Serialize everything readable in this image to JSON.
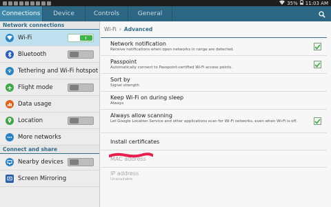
{
  "status_bar": {
    "battery": "35%",
    "time": "11:03 AM"
  },
  "tabs": [
    {
      "label": "Connections",
      "active": true
    },
    {
      "label": "Device",
      "active": false
    },
    {
      "label": "Controls",
      "active": false
    },
    {
      "label": "General",
      "active": false
    }
  ],
  "sidebar": {
    "section_network": "Network connections",
    "section_share": "Connect and share",
    "items": [
      {
        "label": "Wi-Fi",
        "icon": "wifi-icon",
        "color": "#2c83c2",
        "switch": "on"
      },
      {
        "label": "Bluetooth",
        "icon": "bluetooth-icon",
        "color": "#2a5fb8",
        "switch": "off"
      },
      {
        "label": "Tethering and Wi-Fi hotspot",
        "icon": "hotspot-icon",
        "color": "#2c83c2",
        "switch": null
      },
      {
        "label": "Flight mode",
        "icon": "airplane-icon",
        "color": "#3fa547",
        "switch": "off"
      },
      {
        "label": "Data usage",
        "icon": "data-usage-icon",
        "color": "#e0621f",
        "switch": null
      },
      {
        "label": "Location",
        "icon": "location-icon",
        "color": "#3fa547",
        "switch": "off"
      },
      {
        "label": "More networks",
        "icon": "more-networks-icon",
        "color": "#2c83c2",
        "switch": null
      },
      {
        "label": "Nearby devices",
        "icon": "nearby-devices-icon",
        "color": "#2c83c2",
        "switch": "off"
      },
      {
        "label": "Screen Mirroring",
        "icon": "screen-mirroring-icon",
        "color": "#2c5fa8",
        "switch": null
      }
    ]
  },
  "breadcrumb": {
    "parent": "Wi-Fi",
    "current": "Advanced"
  },
  "settings": [
    {
      "title": "Network notification",
      "subtitle": "Receive notifications when open networks in range are detected.",
      "checked": true,
      "enabled": true
    },
    {
      "title": "Passpoint",
      "subtitle": "Automatically connect to Passpoint-certified Wi-Fi access points.",
      "checked": true,
      "enabled": true
    },
    {
      "title": "Sort by",
      "subtitle": "Signal strength",
      "checked": null,
      "enabled": true
    },
    {
      "title": "Keep Wi-Fi on during sleep",
      "subtitle": "Always",
      "checked": null,
      "enabled": true
    },
    {
      "title": "Always allow scanning",
      "subtitle": "Let Google Location Service and other applications scan for Wi-Fi networks, even when Wi-Fi is off.",
      "checked": true,
      "enabled": true
    },
    {
      "title": "Install certificates",
      "subtitle": "",
      "checked": null,
      "enabled": true
    },
    {
      "title": "MAC address",
      "subtitle": "",
      "checked": null,
      "enabled": false
    },
    {
      "title": "IP address",
      "subtitle": "Unavailable",
      "checked": null,
      "enabled": false
    }
  ],
  "colors": {
    "tab_bar": "#2d6683",
    "tab_active": "#3f88aa",
    "accent": "#2f6c8a",
    "check_green": "#3fa547",
    "redaction": "#e8204e"
  }
}
